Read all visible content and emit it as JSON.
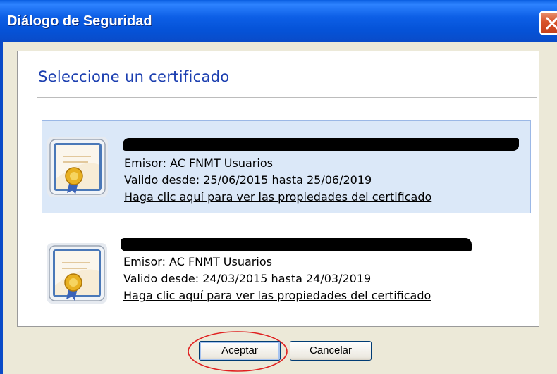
{
  "window": {
    "title": "Diálogo de Seguridad",
    "close_icon": "close-icon"
  },
  "dialog": {
    "heading": "Seleccione un certificado"
  },
  "certificates": [
    {
      "name": "[redacted]",
      "issuer": "Emisor: AC FNMT Usuarios",
      "validity": "Valido desde: 25/06/2015 hasta 25/06/2019",
      "link": "Haga clic aquí para ver las propiedades del certificado",
      "selected": true,
      "icon": "certificate-icon"
    },
    {
      "name": "[redacted]",
      "issuer": "Emisor: AC FNMT Usuarios",
      "validity": "Valido desde: 24/03/2015 hasta 24/03/2019",
      "link": "Haga clic aquí para ver las propiedades del certificado",
      "selected": false,
      "icon": "certificate-icon"
    }
  ],
  "buttons": {
    "accept": "Aceptar",
    "cancel": "Cancelar"
  },
  "colors": {
    "titlebar": "#0553d8",
    "heading": "#1c3fb0",
    "selection": "#dbe8f8",
    "highlight_ellipse": "#e02020"
  }
}
